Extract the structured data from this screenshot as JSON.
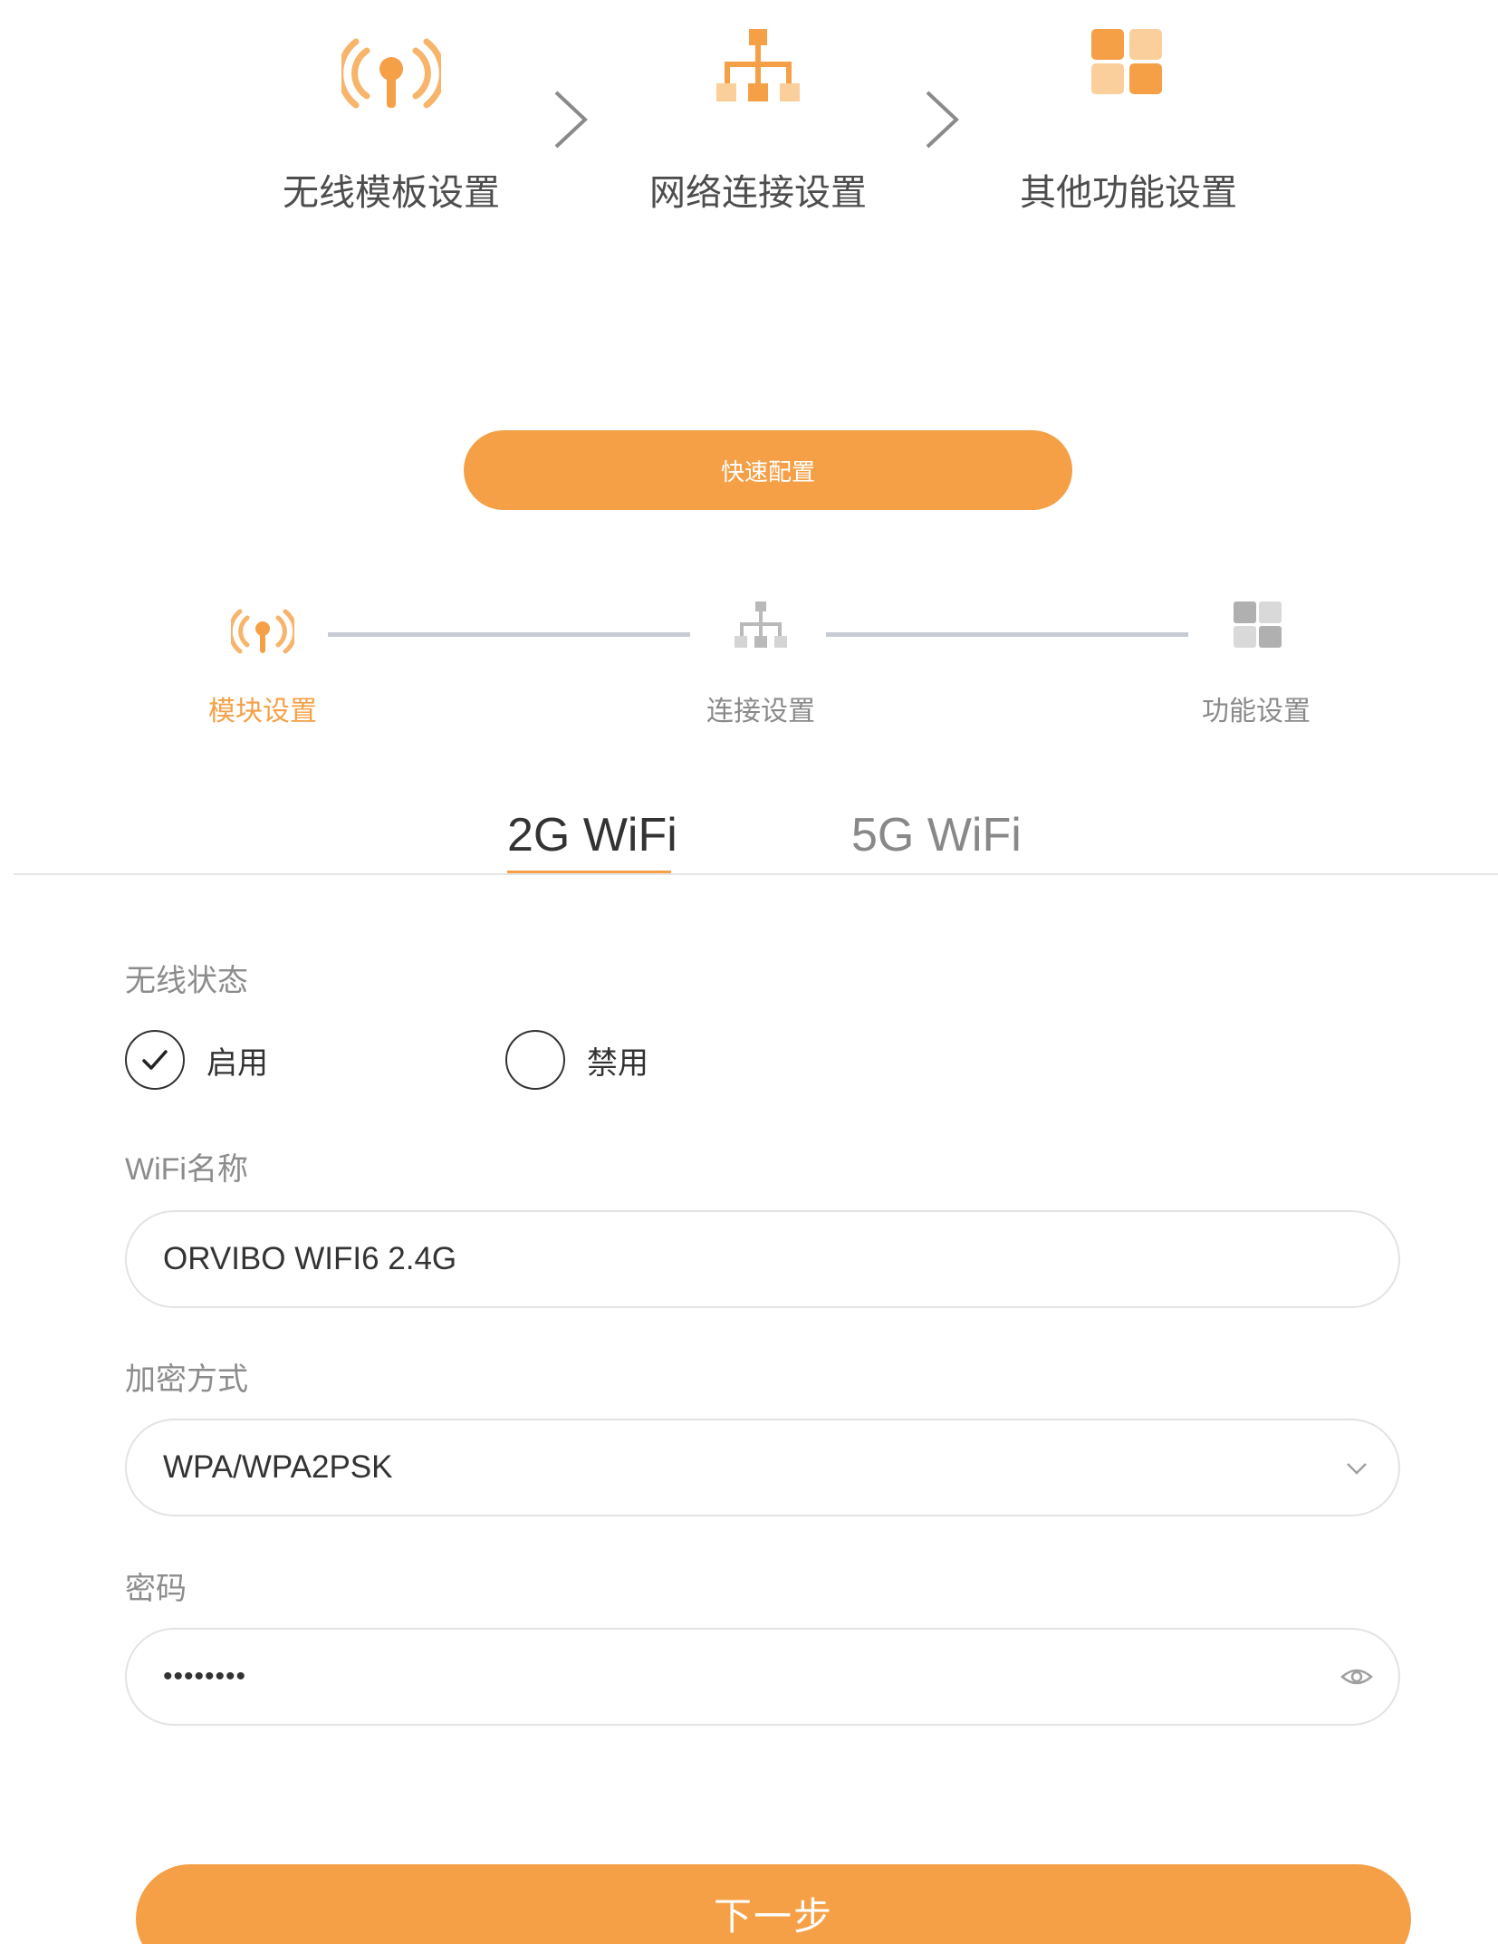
{
  "overview": {
    "steps": [
      {
        "label": "无线模板设置",
        "icon": "wifi-antenna-icon"
      },
      {
        "label": "网络连接设置",
        "icon": "network-tree-icon"
      },
      {
        "label": "其他功能设置",
        "icon": "grid-icon"
      }
    ],
    "arrow_icon": "chevron-right-icon"
  },
  "quick_config": {
    "label": "快速配置"
  },
  "progress": {
    "steps": [
      {
        "label": "模块设置",
        "state": "active"
      },
      {
        "label": "连接设置",
        "state": "pending"
      },
      {
        "label": "功能设置",
        "state": "pending"
      }
    ]
  },
  "tabs": [
    {
      "label": "2G WiFi",
      "active": true
    },
    {
      "label": "5G WiFi",
      "active": false
    }
  ],
  "form": {
    "wireless_status": {
      "label": "无线状态",
      "options": [
        {
          "label": "启用",
          "selected": true
        },
        {
          "label": "禁用",
          "selected": false
        }
      ]
    },
    "wifi_name": {
      "label": "WiFi名称",
      "value": "ORVIBO WIFI6 2.4G"
    },
    "encryption": {
      "label": "加密方式",
      "value": "WPA/WPA2PSK"
    },
    "password": {
      "label": "密码",
      "value": "••••••••"
    }
  },
  "next_button": {
    "label": "下一步"
  },
  "colors": {
    "accent": "#f5a047",
    "accent_light": "#fbcf9c",
    "inactive_icon": "#c8c8c8",
    "line": "#c7cbd3"
  }
}
